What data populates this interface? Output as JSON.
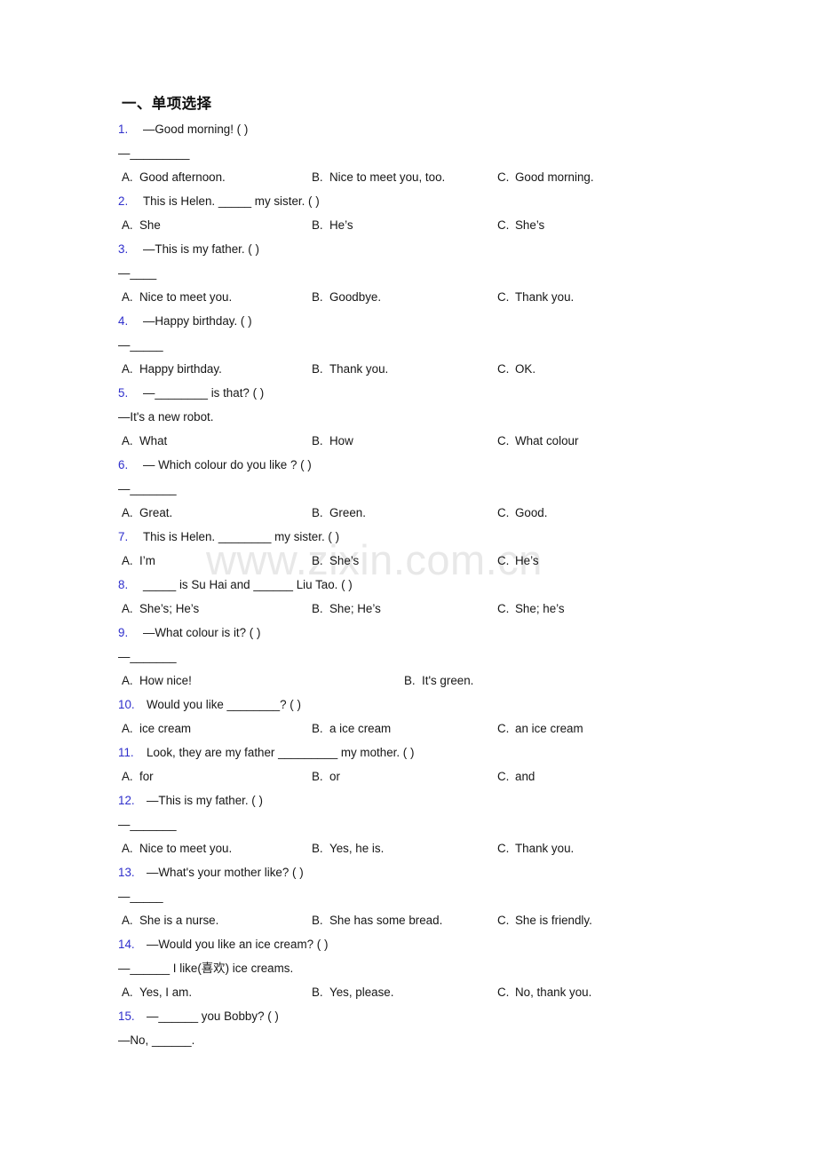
{
  "watermark": {
    "text": "www.zixin.com.cn",
    "color": "#e8e8e8"
  },
  "section": {
    "title": "一、单项选择",
    "number_color": "#2f2fcc"
  },
  "questions": [
    {
      "num": "1.",
      "stem": "—Good morning! (   )",
      "prompt": "—_________",
      "options": [
        {
          "key": "A.",
          "text": "Good afternoon."
        },
        {
          "key": "B.",
          "text": "Nice to meet you, too."
        },
        {
          "key": "C.",
          "text": "Good morning."
        }
      ]
    },
    {
      "num": "2.",
      "stem": "This is Helen. _____ my sister. (   )",
      "prompt": null,
      "options": [
        {
          "key": "A.",
          "text": "She"
        },
        {
          "key": "B.",
          "text": "He’s"
        },
        {
          "key": "C.",
          "text": "She’s"
        }
      ]
    },
    {
      "num": "3.",
      "stem": "—This is my father. (    )",
      "prompt": "—____",
      "options": [
        {
          "key": "A.",
          "text": "Nice to meet you."
        },
        {
          "key": "B.",
          "text": "Goodbye."
        },
        {
          "key": "C.",
          "text": "Thank you."
        }
      ]
    },
    {
      "num": "4.",
      "stem": "—Happy birthday. (   )",
      "prompt": "—_____",
      "options": [
        {
          "key": "A.",
          "text": "Happy birthday."
        },
        {
          "key": "B.",
          "text": "Thank you."
        },
        {
          "key": "C.",
          "text": "OK."
        }
      ]
    },
    {
      "num": "5.",
      "stem": "—________ is that? (  )",
      "prompt": "—It's a new robot.",
      "options": [
        {
          "key": "A.",
          "text": "What"
        },
        {
          "key": "B.",
          "text": "How"
        },
        {
          "key": "C.",
          "text": "What colour"
        }
      ]
    },
    {
      "num": "6.",
      "stem": "— Which colour do you like ? (  )",
      "prompt": "—_______",
      "options": [
        {
          "key": "A.",
          "text": "Great."
        },
        {
          "key": "B.",
          "text": "Green."
        },
        {
          "key": "C.",
          "text": "Good."
        }
      ]
    },
    {
      "num": "7.",
      "stem": "This is Helen. ________ my sister. (  )",
      "prompt": null,
      "options": [
        {
          "key": "A.",
          "text": "I’m"
        },
        {
          "key": "B.",
          "text": "She’s"
        },
        {
          "key": "C.",
          "text": "He’s"
        }
      ]
    },
    {
      "num": "8.",
      "stem": "_____ is Su Hai and ______ Liu Tao. (  )",
      "prompt": null,
      "options": [
        {
          "key": "A.",
          "text": "She’s; He’s"
        },
        {
          "key": "B.",
          "text": "She; He’s"
        },
        {
          "key": "C.",
          "text": "She; he’s"
        }
      ]
    },
    {
      "num": "9.",
      "stem": "—What colour is it? (  )",
      "prompt": "—_______",
      "options": [
        {
          "key": "A.",
          "text": "How nice!"
        },
        {
          "key": "B.",
          "text": "It's green."
        }
      ]
    },
    {
      "num": "10.",
      "stem": "Would you like ________? (   )",
      "prompt": null,
      "options": [
        {
          "key": "A.",
          "text": "ice cream"
        },
        {
          "key": "B.",
          "text": "a ice cream"
        },
        {
          "key": "C.",
          "text": "an ice cream"
        }
      ]
    },
    {
      "num": "11.",
      "stem": "Look, they are my father _________ my mother. ( )",
      "prompt": null,
      "options": [
        {
          "key": "A.",
          "text": "for"
        },
        {
          "key": "B.",
          "text": "or"
        },
        {
          "key": "C.",
          "text": "and"
        }
      ]
    },
    {
      "num": "12.",
      "stem": "—This is my father. (  )",
      "prompt": "—_______",
      "options": [
        {
          "key": "A.",
          "text": "Nice to meet you."
        },
        {
          "key": "B.",
          "text": "Yes, he is."
        },
        {
          "key": "C.",
          "text": "Thank you."
        }
      ]
    },
    {
      "num": "13.",
      "stem": "—What's your mother like? (  )",
      "prompt": "—_____",
      "options": [
        {
          "key": "A.",
          "text": "She is a nurse."
        },
        {
          "key": "B.",
          "text": "She has some bread."
        },
        {
          "key": "C.",
          "text": "She is friendly."
        }
      ]
    },
    {
      "num": "14.",
      "stem": "—Would you like an ice cream? (   )",
      "prompt": "—______ I like(喜欢) ice creams.",
      "options": [
        {
          "key": "A.",
          "text": "Yes, I am."
        },
        {
          "key": "B.",
          "text": "Yes, please."
        },
        {
          "key": "C.",
          "text": "No, thank you."
        }
      ]
    },
    {
      "num": "15.",
      "stem": "—______ you Bobby? (   )",
      "prompt": "—No, ______.",
      "options": []
    }
  ]
}
